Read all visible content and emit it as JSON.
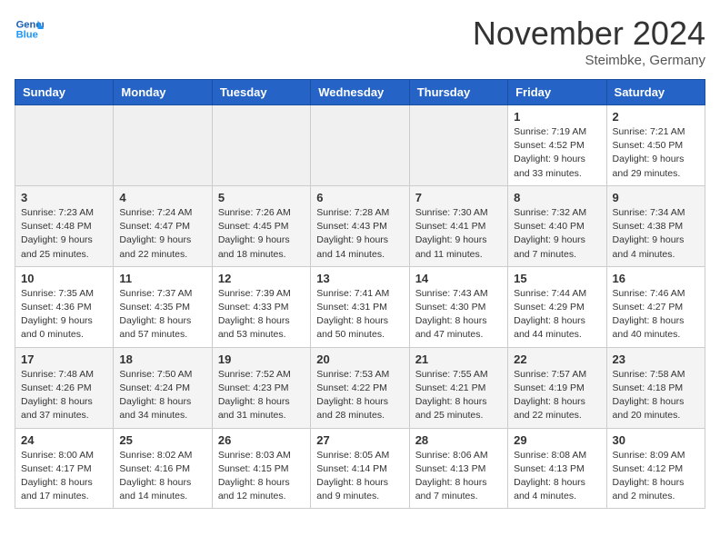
{
  "header": {
    "logo_line1": "General",
    "logo_line2": "Blue",
    "month": "November 2024",
    "location": "Steimbke, Germany"
  },
  "weekdays": [
    "Sunday",
    "Monday",
    "Tuesday",
    "Wednesday",
    "Thursday",
    "Friday",
    "Saturday"
  ],
  "weeks": [
    [
      {
        "day": "",
        "info": ""
      },
      {
        "day": "",
        "info": ""
      },
      {
        "day": "",
        "info": ""
      },
      {
        "day": "",
        "info": ""
      },
      {
        "day": "",
        "info": ""
      },
      {
        "day": "1",
        "info": "Sunrise: 7:19 AM\nSunset: 4:52 PM\nDaylight: 9 hours\nand 33 minutes."
      },
      {
        "day": "2",
        "info": "Sunrise: 7:21 AM\nSunset: 4:50 PM\nDaylight: 9 hours\nand 29 minutes."
      }
    ],
    [
      {
        "day": "3",
        "info": "Sunrise: 7:23 AM\nSunset: 4:48 PM\nDaylight: 9 hours\nand 25 minutes."
      },
      {
        "day": "4",
        "info": "Sunrise: 7:24 AM\nSunset: 4:47 PM\nDaylight: 9 hours\nand 22 minutes."
      },
      {
        "day": "5",
        "info": "Sunrise: 7:26 AM\nSunset: 4:45 PM\nDaylight: 9 hours\nand 18 minutes."
      },
      {
        "day": "6",
        "info": "Sunrise: 7:28 AM\nSunset: 4:43 PM\nDaylight: 9 hours\nand 14 minutes."
      },
      {
        "day": "7",
        "info": "Sunrise: 7:30 AM\nSunset: 4:41 PM\nDaylight: 9 hours\nand 11 minutes."
      },
      {
        "day": "8",
        "info": "Sunrise: 7:32 AM\nSunset: 4:40 PM\nDaylight: 9 hours\nand 7 minutes."
      },
      {
        "day": "9",
        "info": "Sunrise: 7:34 AM\nSunset: 4:38 PM\nDaylight: 9 hours\nand 4 minutes."
      }
    ],
    [
      {
        "day": "10",
        "info": "Sunrise: 7:35 AM\nSunset: 4:36 PM\nDaylight: 9 hours\nand 0 minutes."
      },
      {
        "day": "11",
        "info": "Sunrise: 7:37 AM\nSunset: 4:35 PM\nDaylight: 8 hours\nand 57 minutes."
      },
      {
        "day": "12",
        "info": "Sunrise: 7:39 AM\nSunset: 4:33 PM\nDaylight: 8 hours\nand 53 minutes."
      },
      {
        "day": "13",
        "info": "Sunrise: 7:41 AM\nSunset: 4:31 PM\nDaylight: 8 hours\nand 50 minutes."
      },
      {
        "day": "14",
        "info": "Sunrise: 7:43 AM\nSunset: 4:30 PM\nDaylight: 8 hours\nand 47 minutes."
      },
      {
        "day": "15",
        "info": "Sunrise: 7:44 AM\nSunset: 4:29 PM\nDaylight: 8 hours\nand 44 minutes."
      },
      {
        "day": "16",
        "info": "Sunrise: 7:46 AM\nSunset: 4:27 PM\nDaylight: 8 hours\nand 40 minutes."
      }
    ],
    [
      {
        "day": "17",
        "info": "Sunrise: 7:48 AM\nSunset: 4:26 PM\nDaylight: 8 hours\nand 37 minutes."
      },
      {
        "day": "18",
        "info": "Sunrise: 7:50 AM\nSunset: 4:24 PM\nDaylight: 8 hours\nand 34 minutes."
      },
      {
        "day": "19",
        "info": "Sunrise: 7:52 AM\nSunset: 4:23 PM\nDaylight: 8 hours\nand 31 minutes."
      },
      {
        "day": "20",
        "info": "Sunrise: 7:53 AM\nSunset: 4:22 PM\nDaylight: 8 hours\nand 28 minutes."
      },
      {
        "day": "21",
        "info": "Sunrise: 7:55 AM\nSunset: 4:21 PM\nDaylight: 8 hours\nand 25 minutes."
      },
      {
        "day": "22",
        "info": "Sunrise: 7:57 AM\nSunset: 4:19 PM\nDaylight: 8 hours\nand 22 minutes."
      },
      {
        "day": "23",
        "info": "Sunrise: 7:58 AM\nSunset: 4:18 PM\nDaylight: 8 hours\nand 20 minutes."
      }
    ],
    [
      {
        "day": "24",
        "info": "Sunrise: 8:00 AM\nSunset: 4:17 PM\nDaylight: 8 hours\nand 17 minutes."
      },
      {
        "day": "25",
        "info": "Sunrise: 8:02 AM\nSunset: 4:16 PM\nDaylight: 8 hours\nand 14 minutes."
      },
      {
        "day": "26",
        "info": "Sunrise: 8:03 AM\nSunset: 4:15 PM\nDaylight: 8 hours\nand 12 minutes."
      },
      {
        "day": "27",
        "info": "Sunrise: 8:05 AM\nSunset: 4:14 PM\nDaylight: 8 hours\nand 9 minutes."
      },
      {
        "day": "28",
        "info": "Sunrise: 8:06 AM\nSunset: 4:13 PM\nDaylight: 8 hours\nand 7 minutes."
      },
      {
        "day": "29",
        "info": "Sunrise: 8:08 AM\nSunset: 4:13 PM\nDaylight: 8 hours\nand 4 minutes."
      },
      {
        "day": "30",
        "info": "Sunrise: 8:09 AM\nSunset: 4:12 PM\nDaylight: 8 hours\nand 2 minutes."
      }
    ]
  ]
}
